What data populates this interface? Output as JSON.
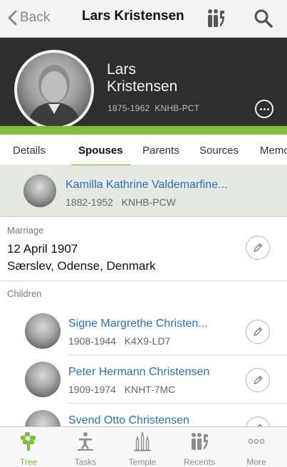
{
  "nav": {
    "back_label": "Back",
    "title": "Lars Kristensen"
  },
  "person": {
    "given_name": "Lars",
    "surname": "Kristensen",
    "lifespan": "1875-1962",
    "pid": "KNHB-PCT"
  },
  "tabs": [
    {
      "label": "Details",
      "active": false
    },
    {
      "label": "Spouses",
      "active": true
    },
    {
      "label": "Parents",
      "active": false
    },
    {
      "label": "Sources",
      "active": false
    },
    {
      "label": "Memories",
      "active": false
    }
  ],
  "spouse": {
    "name": "Kamilla Kathrine Valdemarfine...",
    "lifespan": "1882-1952",
    "pid": "KNHB-PCW"
  },
  "marriage": {
    "label": "Marriage",
    "date": "12 April 1907",
    "place": "Særslev, Odense, Denmark"
  },
  "children": {
    "label": "Children",
    "items": [
      {
        "name": "Signe Margrethe Christen...",
        "lifespan": "1908-1944",
        "pid": "K4X9-LD7"
      },
      {
        "name": "Peter Hermann Christensen",
        "lifespan": "1909-1974",
        "pid": "KNHT-7MC"
      },
      {
        "name": "Svend Otto Christensen",
        "lifespan": "",
        "pid": ""
      }
    ]
  },
  "tabbar": [
    {
      "label": "Tree",
      "icon": "tree-icon",
      "active": true
    },
    {
      "label": "Tasks",
      "icon": "tasks-icon",
      "active": false
    },
    {
      "label": "Temple",
      "icon": "temple-icon",
      "active": false
    },
    {
      "label": "Recents",
      "icon": "recents-icon",
      "active": false
    },
    {
      "label": "More",
      "icon": "more-icon",
      "active": false
    }
  ],
  "colors": {
    "accent": "#7bbf3a",
    "link": "#2d6fb4",
    "header_bg": "#2e2e2e"
  }
}
